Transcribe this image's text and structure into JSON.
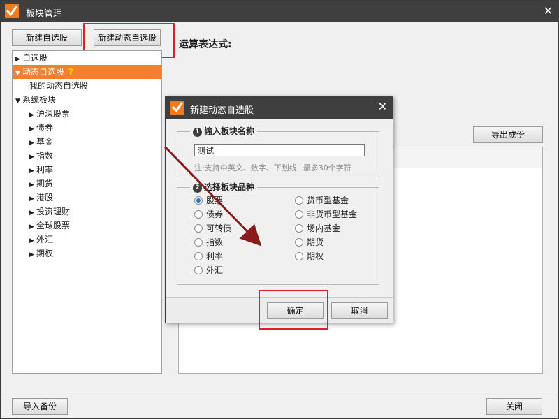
{
  "window": {
    "title": "板块管理"
  },
  "toolbar": {
    "new_self_label": "新建自选股",
    "new_dynamic_label": "新建动态自选股",
    "expression_label": "运算表达式:"
  },
  "tree": {
    "items": [
      {
        "label": "自选股",
        "level": 0,
        "expanded": false,
        "selected": false,
        "has_children": true
      },
      {
        "label": "动态自选股",
        "level": 0,
        "expanded": true,
        "selected": true,
        "has_children": true,
        "help": "?"
      },
      {
        "label": "我的动态自选股",
        "level": 1,
        "expanded": false,
        "selected": false,
        "has_children": false
      },
      {
        "label": "系统板块",
        "level": 0,
        "expanded": true,
        "selected": false,
        "has_children": true
      },
      {
        "label": "沪深股票",
        "level": 1,
        "expanded": false,
        "selected": false,
        "has_children": true
      },
      {
        "label": "债券",
        "level": 1,
        "expanded": false,
        "selected": false,
        "has_children": true
      },
      {
        "label": "基金",
        "level": 1,
        "expanded": false,
        "selected": false,
        "has_children": true
      },
      {
        "label": "指数",
        "level": 1,
        "expanded": false,
        "selected": false,
        "has_children": true
      },
      {
        "label": "利率",
        "level": 1,
        "expanded": false,
        "selected": false,
        "has_children": true
      },
      {
        "label": "期货",
        "level": 1,
        "expanded": false,
        "selected": false,
        "has_children": true
      },
      {
        "label": "港股",
        "level": 1,
        "expanded": false,
        "selected": false,
        "has_children": true
      },
      {
        "label": "投资理财",
        "level": 1,
        "expanded": false,
        "selected": false,
        "has_children": true
      },
      {
        "label": "全球股票",
        "level": 1,
        "expanded": false,
        "selected": false,
        "has_children": true
      },
      {
        "label": "外汇",
        "level": 1,
        "expanded": false,
        "selected": false,
        "has_children": true
      },
      {
        "label": "期权",
        "level": 1,
        "expanded": false,
        "selected": false,
        "has_children": true
      }
    ]
  },
  "right": {
    "export_components_label": "导出成份"
  },
  "footer": {
    "import_backup_label": "导入备份",
    "close_label": "关闭"
  },
  "dialog": {
    "title": "新建动态自选股",
    "group1": {
      "number": "1",
      "title": "输入板块名称"
    },
    "name_value": "测试",
    "hint": "注:支持中英文、数字、下划线_ 最多30个字符",
    "group2": {
      "number": "2",
      "title": "选择板块品种"
    },
    "options_left": [
      {
        "label": "股票",
        "checked": true
      },
      {
        "label": "债券",
        "checked": false
      },
      {
        "label": "可转债",
        "checked": false
      },
      {
        "label": "指数",
        "checked": false
      },
      {
        "label": "利率",
        "checked": false
      },
      {
        "label": "外汇",
        "checked": false
      }
    ],
    "options_right": [
      {
        "label": "货币型基金",
        "checked": false
      },
      {
        "label": "非货币型基金",
        "checked": false
      },
      {
        "label": "场内基金",
        "checked": false
      },
      {
        "label": "期货",
        "checked": false
      },
      {
        "label": "期权",
        "checked": false
      }
    ],
    "ok_label": "确定",
    "cancel_label": "取消"
  },
  "colors": {
    "titlebar": "#3f3f3f",
    "brand_orange": "#f07a1e",
    "selection": "#f47f2e",
    "highlight_box": "#e02020",
    "annotation_arrow": "#8b1a1a"
  },
  "icons": {
    "logo": "orange-check-logo-icon",
    "close": "close-icon",
    "expand": "triangle-down-icon",
    "collapse": "triangle-right-icon"
  }
}
